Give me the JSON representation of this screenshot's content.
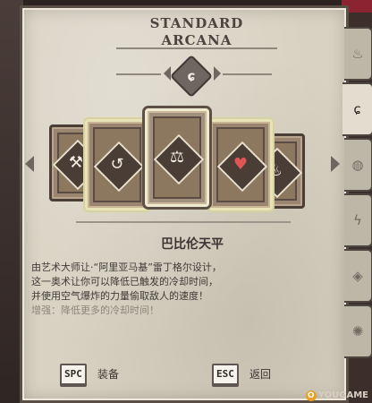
{
  "header": {
    "title_line1": "STANDARD",
    "title_line2": "ARCANA",
    "category_icon": "wind-swirl-icon",
    "category_glyph": "ɕ"
  },
  "carousel": {
    "cards": [
      {
        "id": "card-1",
        "symbol": "⚒",
        "icon": "shuriken-icon"
      },
      {
        "id": "card-2",
        "symbol": "↺",
        "icon": "tornado-icon"
      },
      {
        "id": "card-3",
        "symbol": "⚖",
        "icon": "scales-icon"
      },
      {
        "id": "card-4",
        "symbol": "♥",
        "icon": "hearts-cloud-icon"
      },
      {
        "id": "card-5",
        "symbol": "♨",
        "icon": "gust-icon"
      }
    ],
    "selected_index": 2
  },
  "arcana": {
    "name": "巴比伦天平",
    "description": [
      "由艺术大师让·“阿里亚马基”雷丁格尔设计，",
      "这一奥术让你可以降低已触发的冷却时间，",
      "并使用空气爆炸的力量偷取敌人的速度！"
    ],
    "bonus": "增强：降低更多的冷却时间！"
  },
  "controls": {
    "equip_key": "SPC",
    "equip_label": "装备",
    "back_key": "ESC",
    "back_label": "返回"
  },
  "side_tabs": [
    {
      "icon": "flame-icon",
      "glyph": "♨"
    },
    {
      "icon": "wind-icon",
      "glyph": "ɕ"
    },
    {
      "icon": "earth-icon",
      "glyph": "◍"
    },
    {
      "icon": "lightning-icon",
      "glyph": "ϟ"
    },
    {
      "icon": "water-icon",
      "glyph": "◈"
    },
    {
      "icon": "chaos-icon",
      "glyph": "✺"
    }
  ],
  "active_tab_index": 1,
  "watermark": {
    "circle": "O",
    "text": "YOUGAME"
  }
}
